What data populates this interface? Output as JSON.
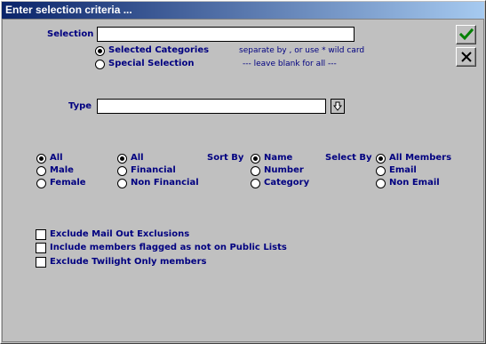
{
  "window": {
    "title": "Enter selection criteria ..."
  },
  "selection": {
    "label": "Selection",
    "value": "",
    "options": [
      {
        "label": "Selected Categories",
        "checked": true
      },
      {
        "label": "Special Selection",
        "checked": false
      }
    ],
    "hint1": "separate by  , or use * wild card",
    "hint2": "---  leave blank for all  ---"
  },
  "type": {
    "label": "Type",
    "value": "",
    "dropdown_icon": "down-arrow-icon"
  },
  "gender_group": [
    {
      "label": "All",
      "checked": true
    },
    {
      "label": "Male",
      "checked": false
    },
    {
      "label": "Female",
      "checked": false
    }
  ],
  "financial_group": [
    {
      "label": "All",
      "checked": true
    },
    {
      "label": "Financial",
      "checked": false
    },
    {
      "label": "Non Financial",
      "checked": false
    }
  ],
  "sort_by": {
    "label": "Sort By",
    "options": [
      {
        "label": "Name",
        "checked": true
      },
      {
        "label": "Number",
        "checked": false
      },
      {
        "label": "Category",
        "checked": false
      }
    ]
  },
  "select_by": {
    "label": "Select By",
    "options": [
      {
        "label": "All Members",
        "checked": true
      },
      {
        "label": "Email",
        "checked": false
      },
      {
        "label": "Non Email",
        "checked": false
      }
    ]
  },
  "checkboxes": [
    {
      "label": "Exclude Mail Out Exclusions",
      "checked": false
    },
    {
      "label": "Include members flagged as not on Public Lists",
      "checked": false
    },
    {
      "label": "Exclude Twilight Only members",
      "checked": false
    }
  ],
  "buttons": {
    "ok_icon": "checkmark-icon",
    "cancel_icon": "cross-icon"
  },
  "colors": {
    "label": "#000080",
    "title_start": "#0a246a",
    "title_end": "#a6caf0",
    "ok_check": "#008000"
  }
}
